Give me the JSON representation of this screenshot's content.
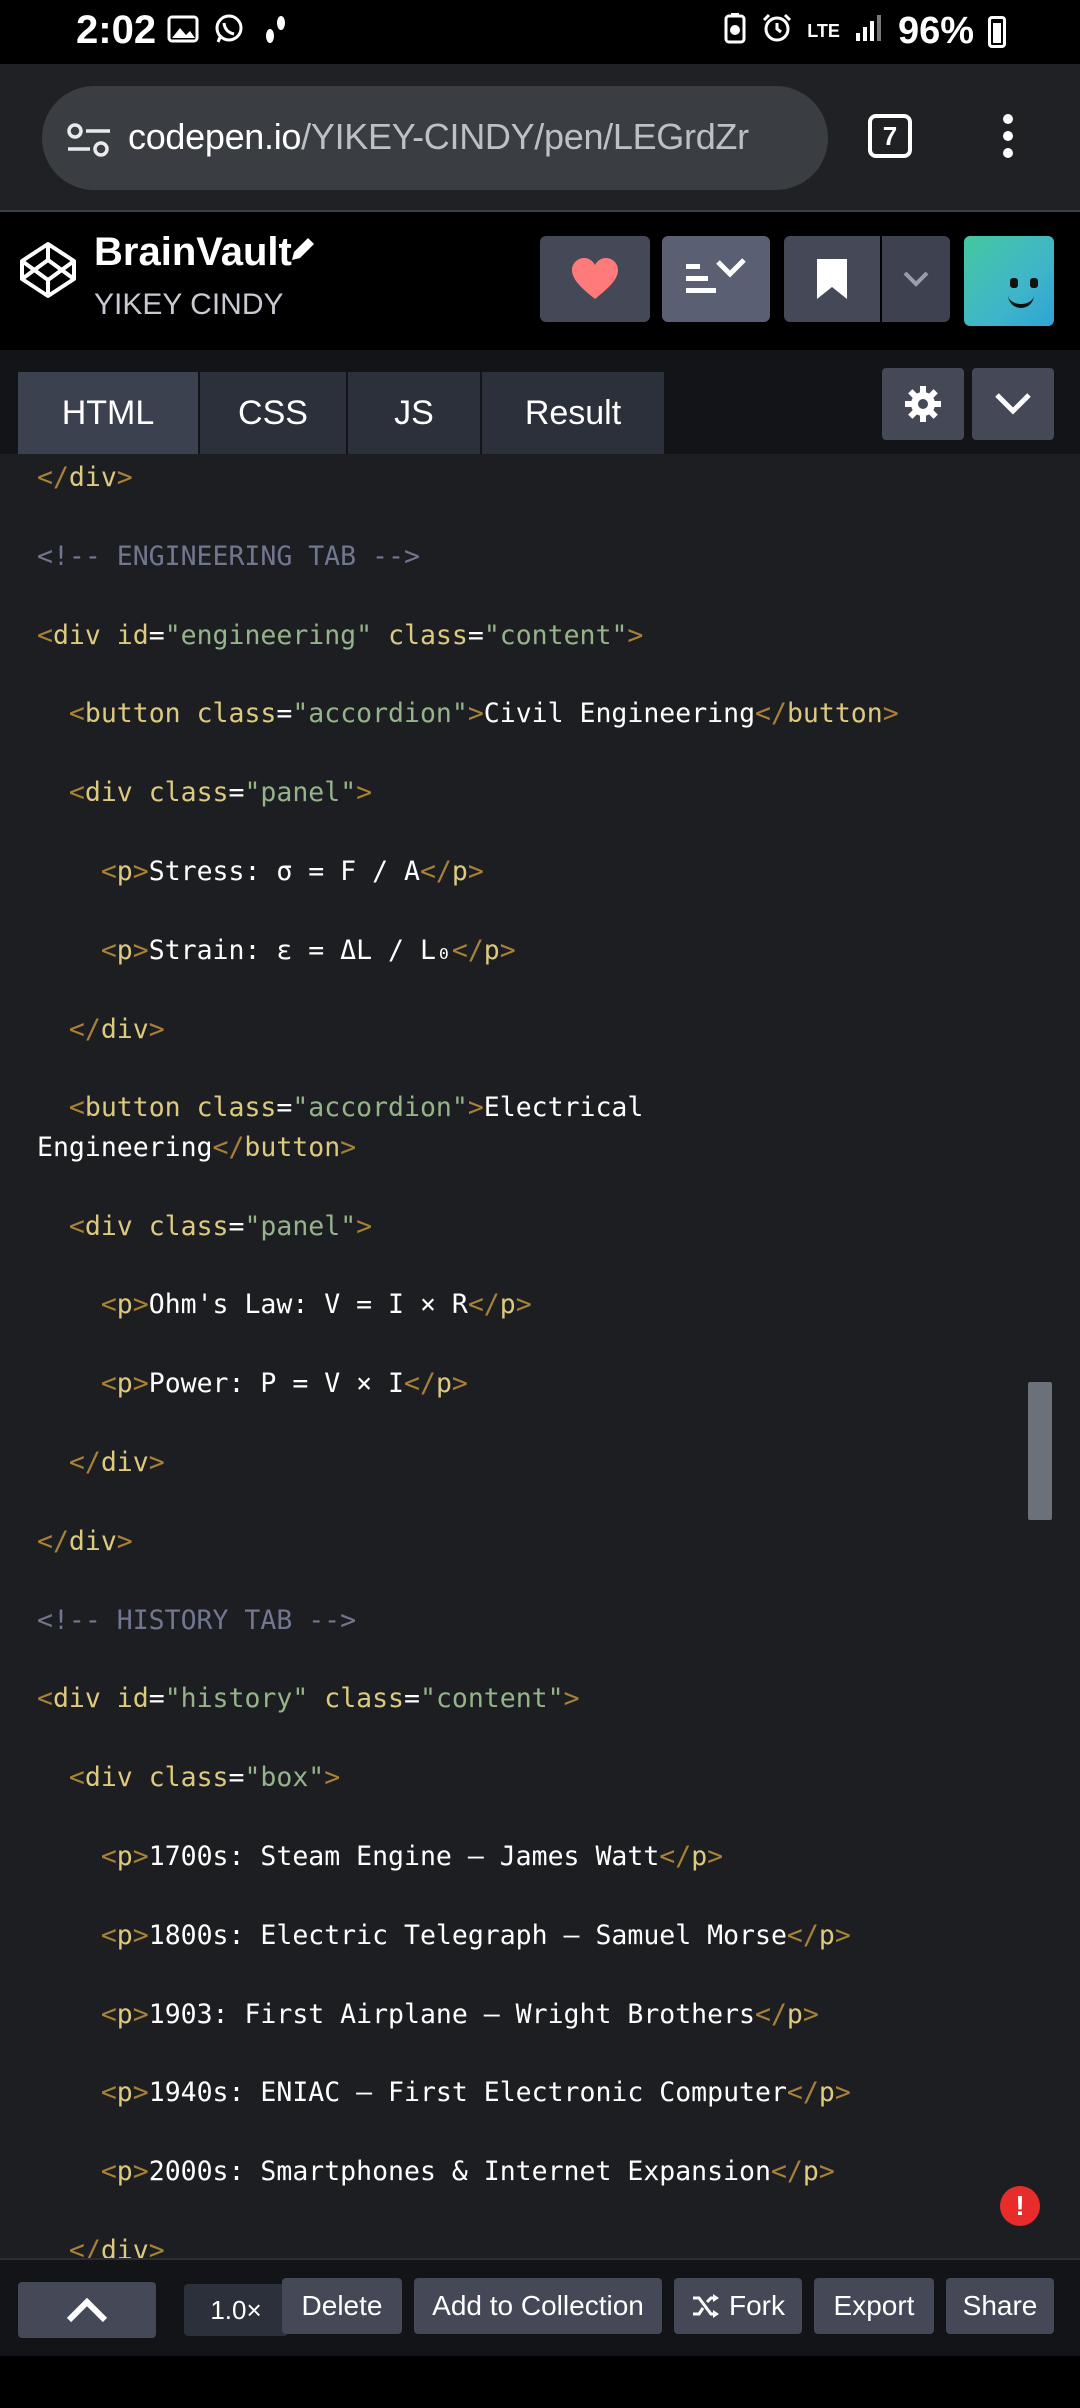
{
  "status_bar": {
    "time": "2:02",
    "battery": "96%",
    "network": "LTE",
    "icons": [
      "gallery-icon",
      "whatsapp-icon",
      "walk-icon",
      "battery-saver-icon",
      "alarm-icon",
      "signal-icon"
    ]
  },
  "browser": {
    "url_host": "codepen.io",
    "url_path": "/YIKEY-CINDY/pen/LEGrdZr",
    "tab_count": "7"
  },
  "pen": {
    "title": "BrainVault",
    "author": "YIKEY CINDY"
  },
  "editor_tabs": {
    "html": "HTML",
    "css": "CSS",
    "js": "JS",
    "result": "Result",
    "active": "HTML"
  },
  "code_lines": [
    {
      "y": 0,
      "parts": [
        [
          "c-tagb",
          "</"
        ],
        [
          "c-tag",
          "div"
        ],
        [
          "c-tagb",
          ">"
        ]
      ]
    },
    {
      "y": 1,
      "parts": [
        [
          "c-comment",
          "<!-- ENGINEERING TAB -->"
        ]
      ]
    },
    {
      "y": 2,
      "parts": [
        [
          "c-tagb",
          "<"
        ],
        [
          "c-tag",
          "div "
        ],
        [
          "c-attr",
          "id"
        ],
        [
          "c-txt",
          "="
        ],
        [
          "c-val",
          "\"engineering\" "
        ],
        [
          "c-attr",
          "class"
        ],
        [
          "c-txt",
          "="
        ],
        [
          "c-val",
          "\"content\""
        ],
        [
          "c-tagb",
          ">"
        ]
      ]
    },
    {
      "y": 3,
      "parts": [
        [
          "c-txt",
          "  "
        ],
        [
          "c-tagb",
          "<"
        ],
        [
          "c-tag",
          "button "
        ],
        [
          "c-attr",
          "class"
        ],
        [
          "c-txt",
          "="
        ],
        [
          "c-val",
          "\"accordion\""
        ],
        [
          "c-tagb",
          ">"
        ],
        [
          "c-txt",
          "Civil Engineering"
        ],
        [
          "c-tagb",
          "</"
        ],
        [
          "c-tag",
          "button"
        ],
        [
          "c-tagb",
          ">"
        ]
      ]
    },
    {
      "y": 4,
      "parts": [
        [
          "c-txt",
          "  "
        ],
        [
          "c-tagb",
          "<"
        ],
        [
          "c-tag",
          "div "
        ],
        [
          "c-attr",
          "class"
        ],
        [
          "c-txt",
          "="
        ],
        [
          "c-val",
          "\"panel\""
        ],
        [
          "c-tagb",
          ">"
        ]
      ]
    },
    {
      "y": 5,
      "parts": [
        [
          "c-txt",
          "    "
        ],
        [
          "c-tagb",
          "<"
        ],
        [
          "c-tag",
          "p"
        ],
        [
          "c-tagb",
          ">"
        ],
        [
          "c-txt",
          "Stress: σ = F / A"
        ],
        [
          "c-tagb",
          "</"
        ],
        [
          "c-tag",
          "p"
        ],
        [
          "c-tagb",
          ">"
        ]
      ]
    },
    {
      "y": 6,
      "parts": [
        [
          "c-txt",
          "    "
        ],
        [
          "c-tagb",
          "<"
        ],
        [
          "c-tag",
          "p"
        ],
        [
          "c-tagb",
          ">"
        ],
        [
          "c-txt",
          "Strain: ε = ΔL / L₀"
        ],
        [
          "c-tagb",
          "</"
        ],
        [
          "c-tag",
          "p"
        ],
        [
          "c-tagb",
          ">"
        ]
      ]
    },
    {
      "y": 7,
      "parts": [
        [
          "c-txt",
          "  "
        ],
        [
          "c-tagb",
          "</"
        ],
        [
          "c-tag",
          "div"
        ],
        [
          "c-tagb",
          ">"
        ]
      ]
    },
    {
      "y": 8,
      "parts": [
        [
          "c-txt",
          "  "
        ],
        [
          "c-tagb",
          "<"
        ],
        [
          "c-tag",
          "button "
        ],
        [
          "c-attr",
          "class"
        ],
        [
          "c-txt",
          "="
        ],
        [
          "c-val",
          "\"accordion\""
        ],
        [
          "c-tagb",
          ">"
        ],
        [
          "c-txt",
          "Electrical"
        ]
      ]
    },
    {
      "y": 8.5,
      "parts": [
        [
          "c-txt",
          "Engineering"
        ],
        [
          "c-tagb",
          "</"
        ],
        [
          "c-tag",
          "button"
        ],
        [
          "c-tagb",
          ">"
        ]
      ]
    },
    {
      "y": 9.5,
      "parts": [
        [
          "c-txt",
          "  "
        ],
        [
          "c-tagb",
          "<"
        ],
        [
          "c-tag",
          "div "
        ],
        [
          "c-attr",
          "class"
        ],
        [
          "c-txt",
          "="
        ],
        [
          "c-val",
          "\"panel\""
        ],
        [
          "c-tagb",
          ">"
        ]
      ]
    },
    {
      "y": 10.5,
      "parts": [
        [
          "c-txt",
          "    "
        ],
        [
          "c-tagb",
          "<"
        ],
        [
          "c-tag",
          "p"
        ],
        [
          "c-tagb",
          ">"
        ],
        [
          "c-txt",
          "Ohm's Law: V = I × R"
        ],
        [
          "c-tagb",
          "</"
        ],
        [
          "c-tag",
          "p"
        ],
        [
          "c-tagb",
          ">"
        ]
      ]
    },
    {
      "y": 11.5,
      "parts": [
        [
          "c-txt",
          "    "
        ],
        [
          "c-tagb",
          "<"
        ],
        [
          "c-tag",
          "p"
        ],
        [
          "c-tagb",
          ">"
        ],
        [
          "c-txt",
          "Power: P = V × I"
        ],
        [
          "c-tagb",
          "</"
        ],
        [
          "c-tag",
          "p"
        ],
        [
          "c-tagb",
          ">"
        ]
      ]
    },
    {
      "y": 12.5,
      "parts": [
        [
          "c-txt",
          "  "
        ],
        [
          "c-tagb",
          "</"
        ],
        [
          "c-tag",
          "div"
        ],
        [
          "c-tagb",
          ">"
        ]
      ]
    },
    {
      "y": 13.5,
      "parts": [
        [
          "c-tagb",
          "</"
        ],
        [
          "c-tag",
          "div"
        ],
        [
          "c-tagb",
          ">"
        ]
      ]
    },
    {
      "y": 14.5,
      "parts": [
        [
          "c-comment",
          "<!-- HISTORY TAB -->"
        ]
      ]
    },
    {
      "y": 15.5,
      "parts": [
        [
          "c-tagb",
          "<"
        ],
        [
          "c-tag",
          "div "
        ],
        [
          "c-attr",
          "id"
        ],
        [
          "c-txt",
          "="
        ],
        [
          "c-val",
          "\"history\" "
        ],
        [
          "c-attr",
          "class"
        ],
        [
          "c-txt",
          "="
        ],
        [
          "c-val",
          "\"content\""
        ],
        [
          "c-tagb",
          ">"
        ]
      ]
    },
    {
      "y": 16.5,
      "parts": [
        [
          "c-txt",
          "  "
        ],
        [
          "c-tagb",
          "<"
        ],
        [
          "c-tag",
          "div "
        ],
        [
          "c-attr",
          "class"
        ],
        [
          "c-txt",
          "="
        ],
        [
          "c-val",
          "\"box\""
        ],
        [
          "c-tagb",
          ">"
        ]
      ]
    },
    {
      "y": 17.5,
      "parts": [
        [
          "c-txt",
          "    "
        ],
        [
          "c-tagb",
          "<"
        ],
        [
          "c-tag",
          "p"
        ],
        [
          "c-tagb",
          ">"
        ],
        [
          "c-txt",
          "1700s: Steam Engine – James Watt"
        ],
        [
          "c-tagb",
          "</"
        ],
        [
          "c-tag",
          "p"
        ],
        [
          "c-tagb",
          ">"
        ]
      ]
    },
    {
      "y": 18.5,
      "parts": [
        [
          "c-txt",
          "    "
        ],
        [
          "c-tagb",
          "<"
        ],
        [
          "c-tag",
          "p"
        ],
        [
          "c-tagb",
          ">"
        ],
        [
          "c-txt",
          "1800s: Electric Telegraph – Samuel Morse"
        ],
        [
          "c-tagb",
          "</"
        ],
        [
          "c-tag",
          "p"
        ],
        [
          "c-tagb",
          ">"
        ]
      ]
    },
    {
      "y": 19.5,
      "parts": [
        [
          "c-txt",
          "    "
        ],
        [
          "c-tagb",
          "<"
        ],
        [
          "c-tag",
          "p"
        ],
        [
          "c-tagb",
          ">"
        ],
        [
          "c-txt",
          "1903: First Airplane – Wright Brothers"
        ],
        [
          "c-tagb",
          "</"
        ],
        [
          "c-tag",
          "p"
        ],
        [
          "c-tagb",
          ">"
        ]
      ]
    },
    {
      "y": 20.5,
      "parts": [
        [
          "c-txt",
          "    "
        ],
        [
          "c-tagb",
          "<"
        ],
        [
          "c-tag",
          "p"
        ],
        [
          "c-tagb",
          ">"
        ],
        [
          "c-txt",
          "1940s: ENIAC – First Electronic Computer"
        ],
        [
          "c-tagb",
          "</"
        ],
        [
          "c-tag",
          "p"
        ],
        [
          "c-tagb",
          ">"
        ]
      ]
    },
    {
      "y": 21.5,
      "parts": [
        [
          "c-txt",
          "    "
        ],
        [
          "c-tagb",
          "<"
        ],
        [
          "c-tag",
          "p"
        ],
        [
          "c-tagb",
          ">"
        ],
        [
          "c-txt",
          "2000s: Smartphones & Internet Expansion"
        ],
        [
          "c-tagb",
          "</"
        ],
        [
          "c-tag",
          "p"
        ],
        [
          "c-tagb",
          ">"
        ]
      ]
    },
    {
      "y": 22.5,
      "parts": [
        [
          "c-txt",
          "  "
        ],
        [
          "c-tagb",
          "</"
        ],
        [
          "c-tag",
          "div"
        ],
        [
          "c-tagb",
          ">"
        ]
      ]
    }
  ],
  "bottom_bar": {
    "zoom": "1.0×",
    "delete": "Delete",
    "add_to_collection": "Add to Collection",
    "fork": "Fork",
    "export": "Export",
    "share": "Share"
  },
  "colors": {
    "editor_bg": "#1d1e22",
    "comment": "#717790",
    "tag": "#ddca7e",
    "attr_value": "#96b38a",
    "heart": "#ff7a7a",
    "error": "#e82c2c"
  }
}
